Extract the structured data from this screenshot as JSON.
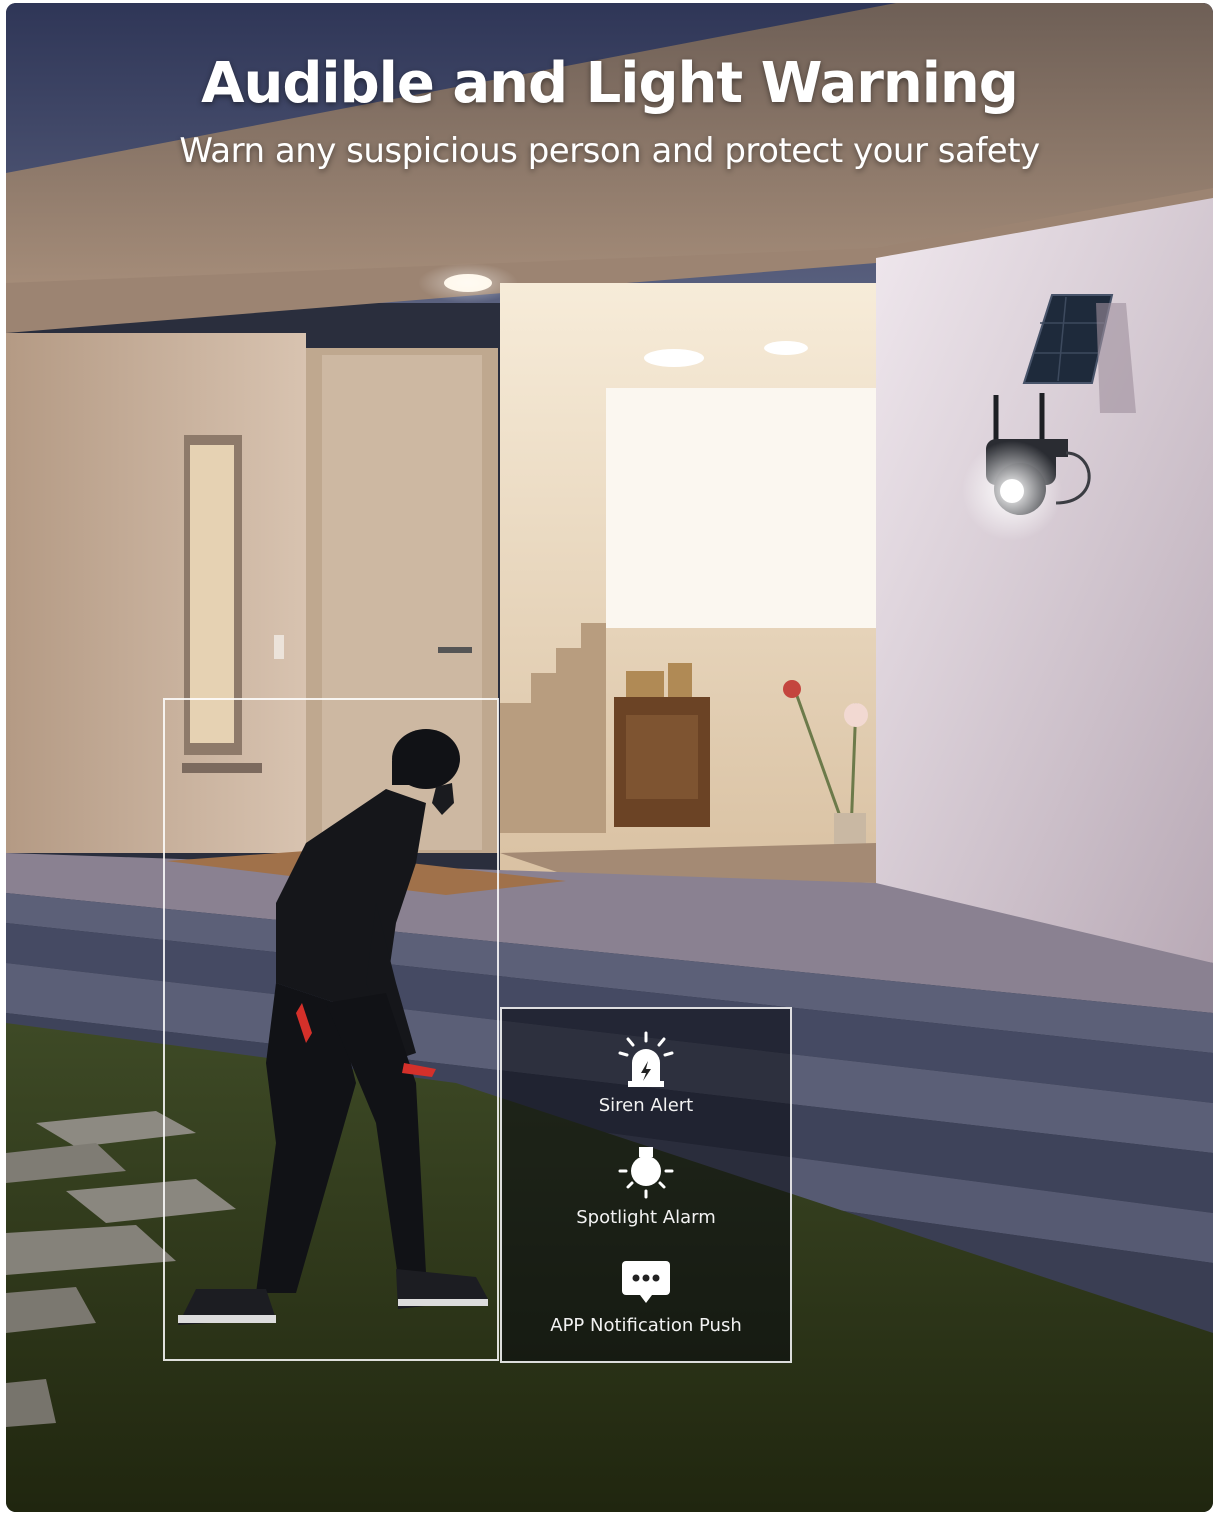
{
  "header": {
    "title": "Audible and Light Warning",
    "subtitle": "Warn any suspicious person and protect your safety"
  },
  "features": [
    {
      "label": "Siren Alert",
      "icon": "siren-icon"
    },
    {
      "label": "Spotlight Alarm",
      "icon": "spotlight-icon"
    },
    {
      "label": "APP Notification Push",
      "icon": "chat-bubble-icon"
    }
  ],
  "colors": {
    "sky": "#3a4263",
    "wall": "#cdb8a6",
    "grass": "#2f3a1e",
    "step": "#4a5069",
    "frame_line": "#ffffff"
  }
}
